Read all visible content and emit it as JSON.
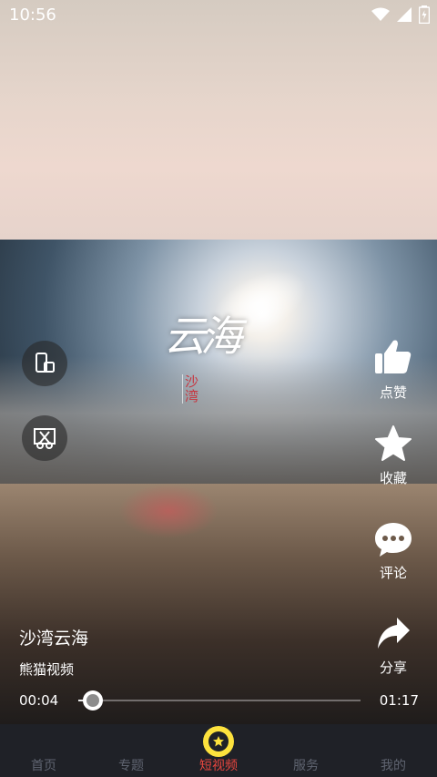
{
  "status_bar": {
    "time": "10:56"
  },
  "video": {
    "logo_main": "云海",
    "logo_sub": "沙湾"
  },
  "actions": [
    {
      "label": "点赞",
      "icon": "thumbs-up-icon"
    },
    {
      "label": "收藏",
      "icon": "star-icon"
    },
    {
      "label": "评论",
      "icon": "comment-icon"
    },
    {
      "label": "分享",
      "icon": "share-icon"
    }
  ],
  "side_buttons": [
    {
      "icon": "screen-rotate-icon"
    },
    {
      "icon": "screenshot-cut-icon"
    }
  ],
  "info": {
    "title": "沙湾云海",
    "author": "熊猫视频"
  },
  "player": {
    "current_time": "00:04",
    "duration": "01:17",
    "progress": 0.052
  },
  "tabs": [
    {
      "label": "首页",
      "active": false
    },
    {
      "label": "专题",
      "active": false
    },
    {
      "label": "短视频",
      "active": true
    },
    {
      "label": "服务",
      "active": false
    },
    {
      "label": "我的",
      "active": false
    }
  ],
  "colors": {
    "accent": "#e8463f",
    "tab_icon": "#fde23d",
    "tabbar": "#1f2127"
  }
}
